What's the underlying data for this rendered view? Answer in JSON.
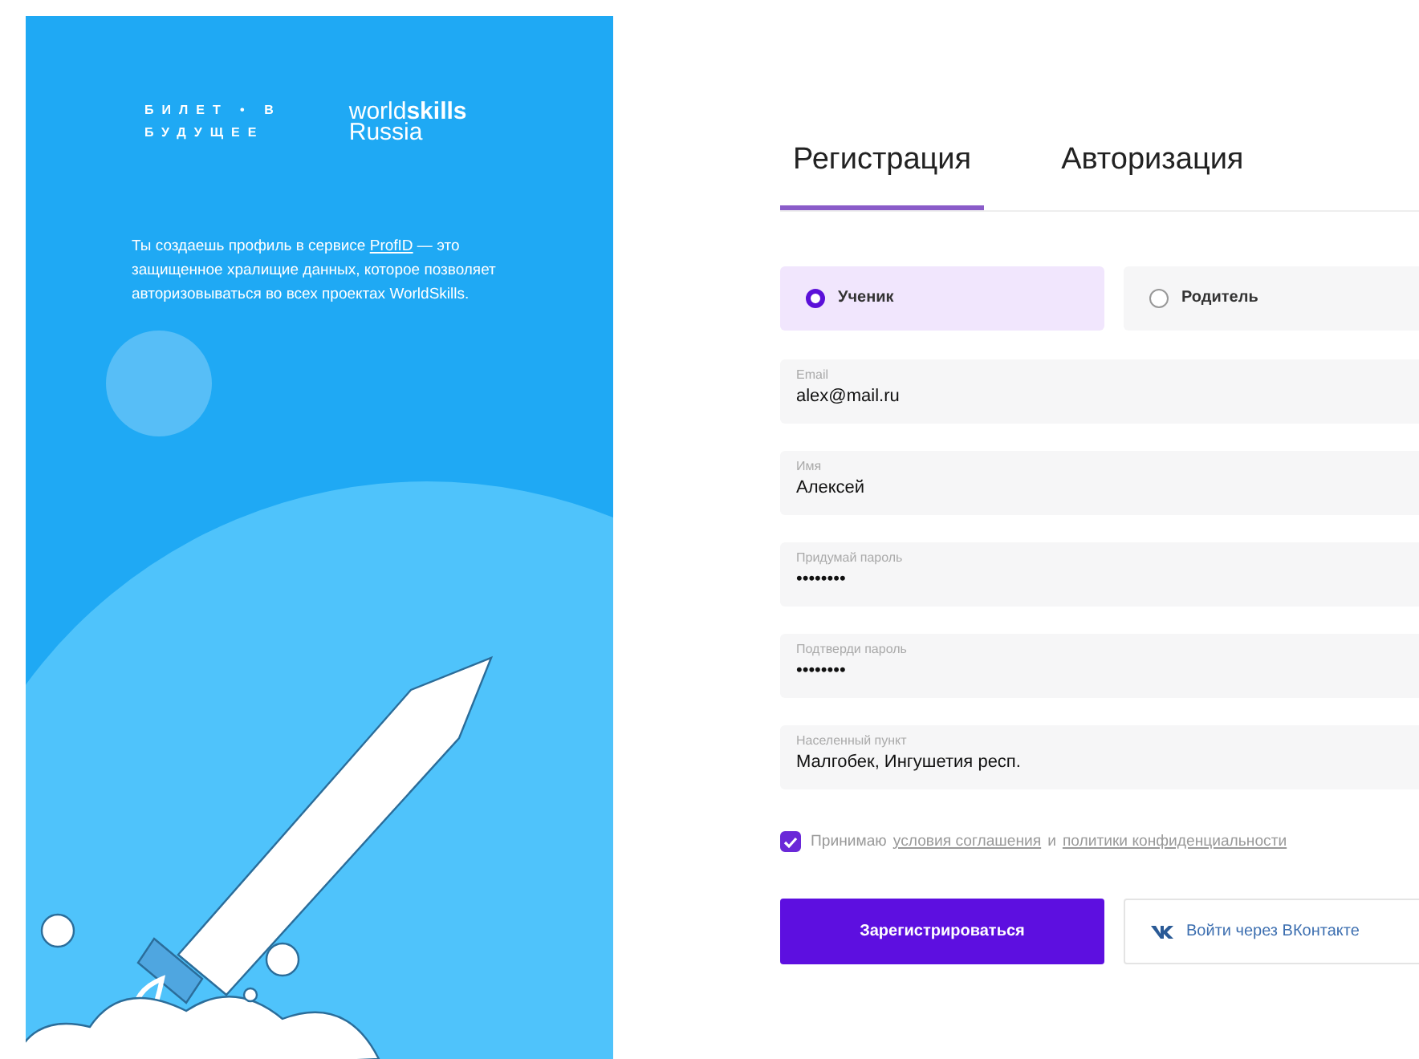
{
  "promo": {
    "logo_left": [
      "БИЛЕТ • В",
      "БУДУЩЕЕ"
    ],
    "logo_right": [
      "world**skills**",
      "Russia"
    ],
    "intro": {
      "before": "Ты создаешь профиль в сервисе ",
      "link": "ProfID",
      "after": " — это защищенное хралищие данных, которое позволяет авторизовываться во всех проектах WorldSkills."
    }
  },
  "tabs": [
    {
      "label": "Регистрация",
      "selected": true
    },
    {
      "label": "Авторизация",
      "selected": false
    }
  ],
  "roles": [
    {
      "label": "Ученик",
      "selected": true
    },
    {
      "label": "Родитель",
      "selected": false
    }
  ],
  "fields": [
    {
      "label": "Email",
      "value": "alex@mail.ru"
    },
    {
      "label": "Имя",
      "value": "Алексей"
    },
    {
      "label": "Придумай пароль",
      "value": "••••••••"
    },
    {
      "label": "Подтверди пароль",
      "value": "••••••••"
    },
    {
      "label": "Населенный пункт",
      "value": "Малгобек, Ингушетия респ."
    }
  ],
  "consent": {
    "checked": true,
    "parts": [
      {
        "kind": "text",
        "text": "Принимаю"
      },
      {
        "kind": "link",
        "text": "условия соглашения"
      },
      {
        "kind": "text",
        "text": "и"
      },
      {
        "kind": "link",
        "text": "политики конфиденциальности"
      }
    ]
  },
  "buttons": [
    {
      "kind": "primary",
      "label": "Зарегистрироваться"
    },
    {
      "kind": "vk",
      "label": "Войти через ВКонтакте"
    }
  ]
}
